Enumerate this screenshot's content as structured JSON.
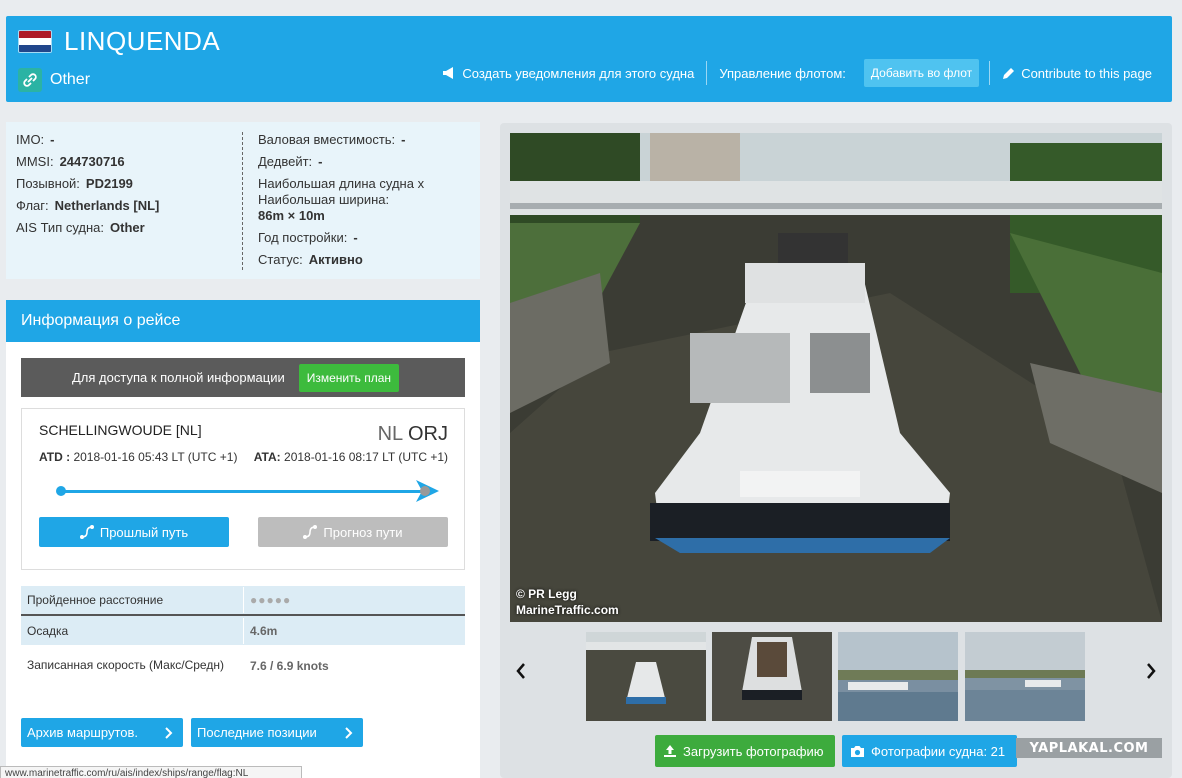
{
  "header": {
    "ship_name": "LINQUENDA",
    "ship_type": "Other",
    "notify_label": "Создать уведомления для этого судна",
    "fleet_label": "Управление флотом:",
    "add_fleet_label": "Добавить во флот",
    "contribute_label": "Contribute to this page"
  },
  "info": {
    "left": [
      {
        "k": "IMO:",
        "v": "-"
      },
      {
        "k": "MMSI:",
        "v": "244730716"
      },
      {
        "k": "Позывной:",
        "v": "PD2199"
      },
      {
        "k": "Флаг:",
        "v": "Netherlands [NL]"
      },
      {
        "k": "AIS Тип судна:",
        "v": "Other"
      }
    ],
    "right": {
      "gt_k": "Валовая вместимость:",
      "gt_v": "-",
      "dwt_k": "Дедвейт:",
      "dwt_v": "-",
      "size_k": "Наибольшая длина судна x Наибольшая ширина:",
      "size_v": "86m × 10m",
      "year_k": "Год постройки:",
      "year_v": "-",
      "status_k": "Статус:",
      "status_v": "Активно"
    }
  },
  "voyage": {
    "title": "Информация о рейсе",
    "access_text": "Для доступа к полной информации",
    "access_btn": "Изменить план",
    "port": "SCHELLINGWOUDE [NL]",
    "code_country": "NL",
    "code_port": "ORJ",
    "atd_label": "ATD :",
    "atd_value": "2018-01-16 05:43 LT (UTC +1)",
    "ata_label": "ATA:",
    "ata_value": "2018-01-16 08:17 LT (UTC +1)",
    "past_btn": "Прошлый путь",
    "forecast_btn": "Прогноз пути",
    "stats": {
      "dist_k": "Пройденное расстояние",
      "dist_v": "●●●●●",
      "draft_k": "Осадка",
      "draft_v": "4.6m",
      "speed_k": "Записанная скорость (Макс/Средн)",
      "speed_v": "7.6 / 6.9 knots"
    },
    "archive_btn": "Архив маршрутов.",
    "positions_btn": "Последние позиции"
  },
  "photo": {
    "credit_line1": "© PR Legg",
    "credit_line2": "MarineTraffic.com",
    "upload_btn": "Загрузить фотографию",
    "photos_btn": "Фотографии судна: 21"
  },
  "statusbar": "www.marinetraffic.com/ru/ais/index/ships/range/flag:NL",
  "watermark": "YAPLAKAL.COM",
  "colors": {
    "brand": "#1fa6e6",
    "green": "#3dbb3d",
    "flag_red": "#ae1c28",
    "flag_blue": "#21468b"
  }
}
